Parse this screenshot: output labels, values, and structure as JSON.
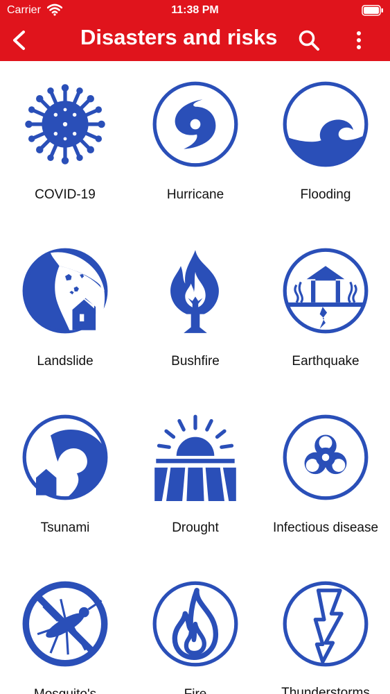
{
  "status_bar": {
    "carrier": "Carrier",
    "time": "11:38 PM"
  },
  "nav": {
    "title": "Disasters and risks",
    "back_icon": "chevron-left-icon",
    "search_icon": "search-icon",
    "more_icon": "more-vertical-icon"
  },
  "colors": {
    "header": "#e0141c",
    "icon_blue": "#2a4fb8",
    "background": "#ffffff"
  },
  "items": [
    {
      "label": "COVID-19",
      "icon": "virus-icon"
    },
    {
      "label": "Hurricane",
      "icon": "hurricane-icon"
    },
    {
      "label": "Flooding",
      "icon": "flood-wave-icon"
    },
    {
      "label": "Landslide",
      "icon": "landslide-icon"
    },
    {
      "label": "Bushfire",
      "icon": "bushfire-icon"
    },
    {
      "label": "Earthquake",
      "icon": "earthquake-icon"
    },
    {
      "label": "Tsunami",
      "icon": "tsunami-icon"
    },
    {
      "label": "Drought",
      "icon": "drought-icon"
    },
    {
      "label": "Infectious disease",
      "icon": "biohazard-icon"
    },
    {
      "label": "Mosquito's",
      "icon": "no-mosquito-icon"
    },
    {
      "label": "Fire",
      "icon": "fire-icon"
    },
    {
      "label": "Thunderstorms",
      "icon": "lightning-icon"
    }
  ]
}
